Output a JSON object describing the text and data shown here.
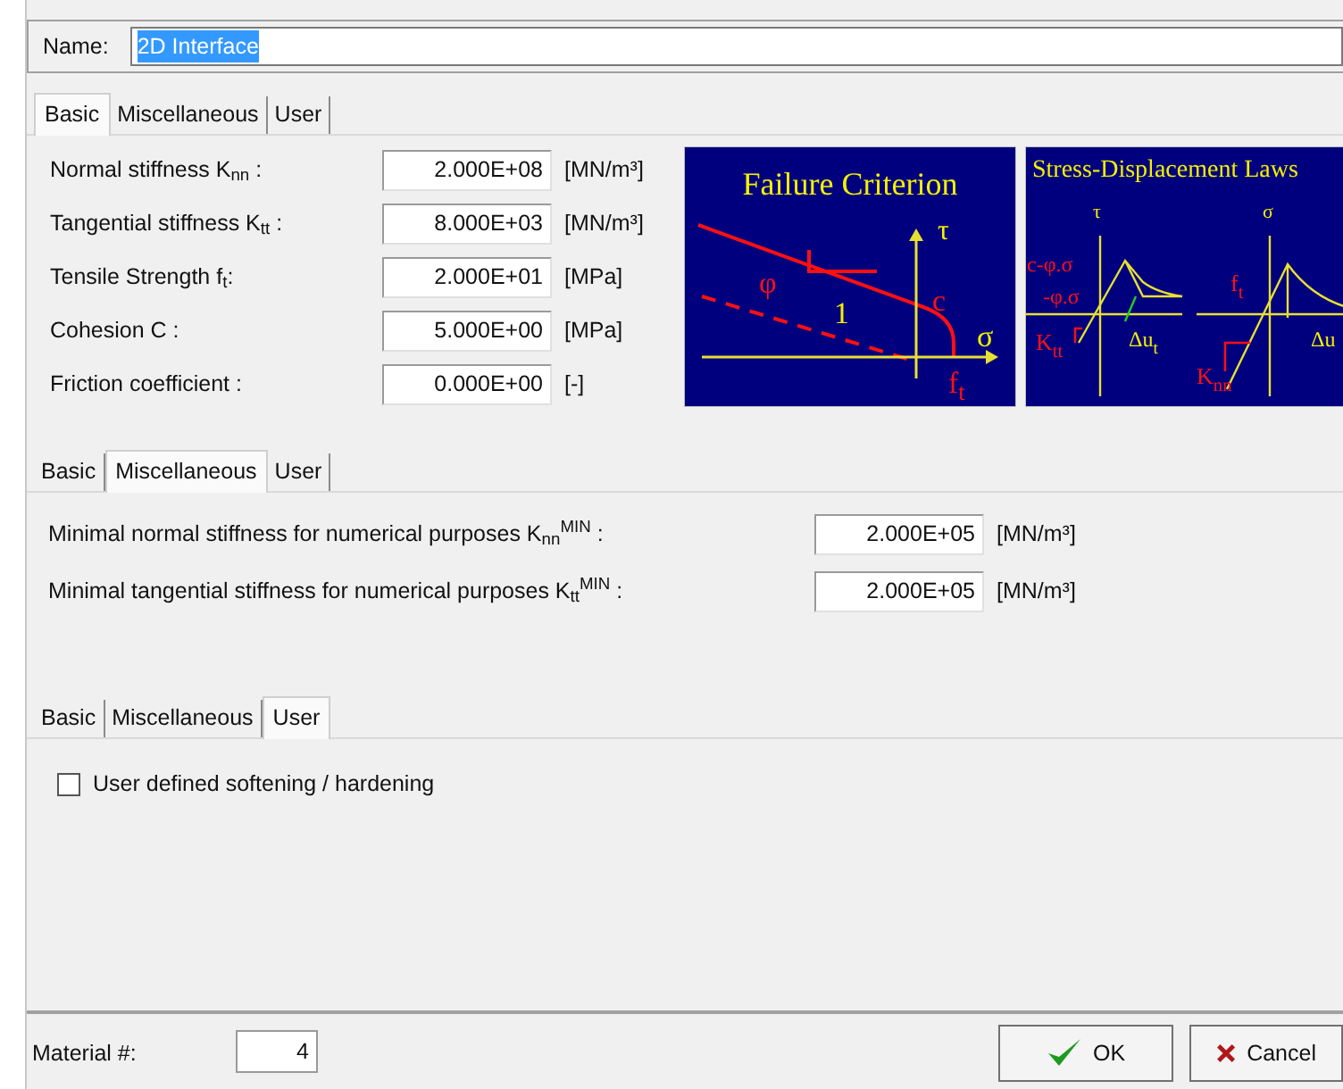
{
  "name_field": {
    "label": "Name:",
    "value": "2D Interface",
    "text_selected": true
  },
  "tab_panels": [
    {
      "kind": "fields",
      "tabs": [
        {
          "label": "Basic",
          "selected": true
        },
        {
          "label": "Miscellaneous",
          "selected": false
        },
        {
          "label": "User",
          "selected": false
        }
      ],
      "fields": [
        {
          "label": "Normal stiffness K$_{nn}$ :",
          "value": "2.000E+08",
          "unit": "[MN/m³]"
        },
        {
          "label": "Tangential stiffness K$_{tt}$ :",
          "value": "8.000E+03",
          "unit": "[MN/m³]"
        },
        {
          "label": "Tensile Strength f$_{t}$:",
          "value": "2.000E+01",
          "unit": "[MPa]"
        },
        {
          "label": "Cohesion C :",
          "value": "5.000E+00",
          "unit": "[MPa]"
        },
        {
          "label": "Friction coefficient :",
          "value": "0.000E+00",
          "unit": "[-]"
        }
      ],
      "diagrams": [
        {
          "title": "Failure Criterion",
          "labels": [
            {
              "text": "τ"
            },
            {
              "text": "σ"
            },
            {
              "text": "φ"
            },
            {
              "text": "1"
            },
            {
              "text": "c"
            },
            {
              "text": "f",
              "sub": "t"
            }
          ]
        },
        {
          "title": "Stress-Displacement Laws",
          "labels": [
            {
              "text": "τ"
            },
            {
              "text": "c-φ.σ"
            },
            {
              "text": "-φ.σ"
            },
            {
              "text": "K",
              "sub": "tt"
            },
            {
              "text": "Δu",
              "sub": "t"
            },
            {
              "text": "σ"
            },
            {
              "text": "f",
              "sub": "t"
            },
            {
              "text": "K",
              "sub": "nn"
            },
            {
              "text": "Δu"
            }
          ]
        }
      ]
    },
    {
      "kind": "fields",
      "tabs": [
        {
          "label": "Basic",
          "selected": false
        },
        {
          "label": "Miscellaneous",
          "selected": true
        },
        {
          "label": "User",
          "selected": false
        }
      ],
      "fields": [
        {
          "label": "Minimal normal stiffness for numerical purposes K$_{nn}$$^{MIN}$ :",
          "value": "2.000E+05",
          "unit": "[MN/m³]"
        },
        {
          "label": "Minimal tangential stiffness for numerical purposes K$_{tt}$$^{MIN}$ :",
          "value": "2.000E+05",
          "unit": "[MN/m³]"
        }
      ]
    },
    {
      "kind": "checkboxes",
      "tabs": [
        {
          "label": "Basic",
          "selected": false
        },
        {
          "label": "Miscellaneous",
          "selected": false
        },
        {
          "label": "User",
          "selected": true
        }
      ],
      "checkboxes": [
        {
          "label": "User defined softening / hardening",
          "checked": false
        }
      ]
    }
  ],
  "material": {
    "label": "Material #:",
    "value": "4"
  },
  "buttons": [
    {
      "kind": "ok",
      "label": "OK"
    },
    {
      "kind": "cancel",
      "label": "Cancel"
    }
  ]
}
